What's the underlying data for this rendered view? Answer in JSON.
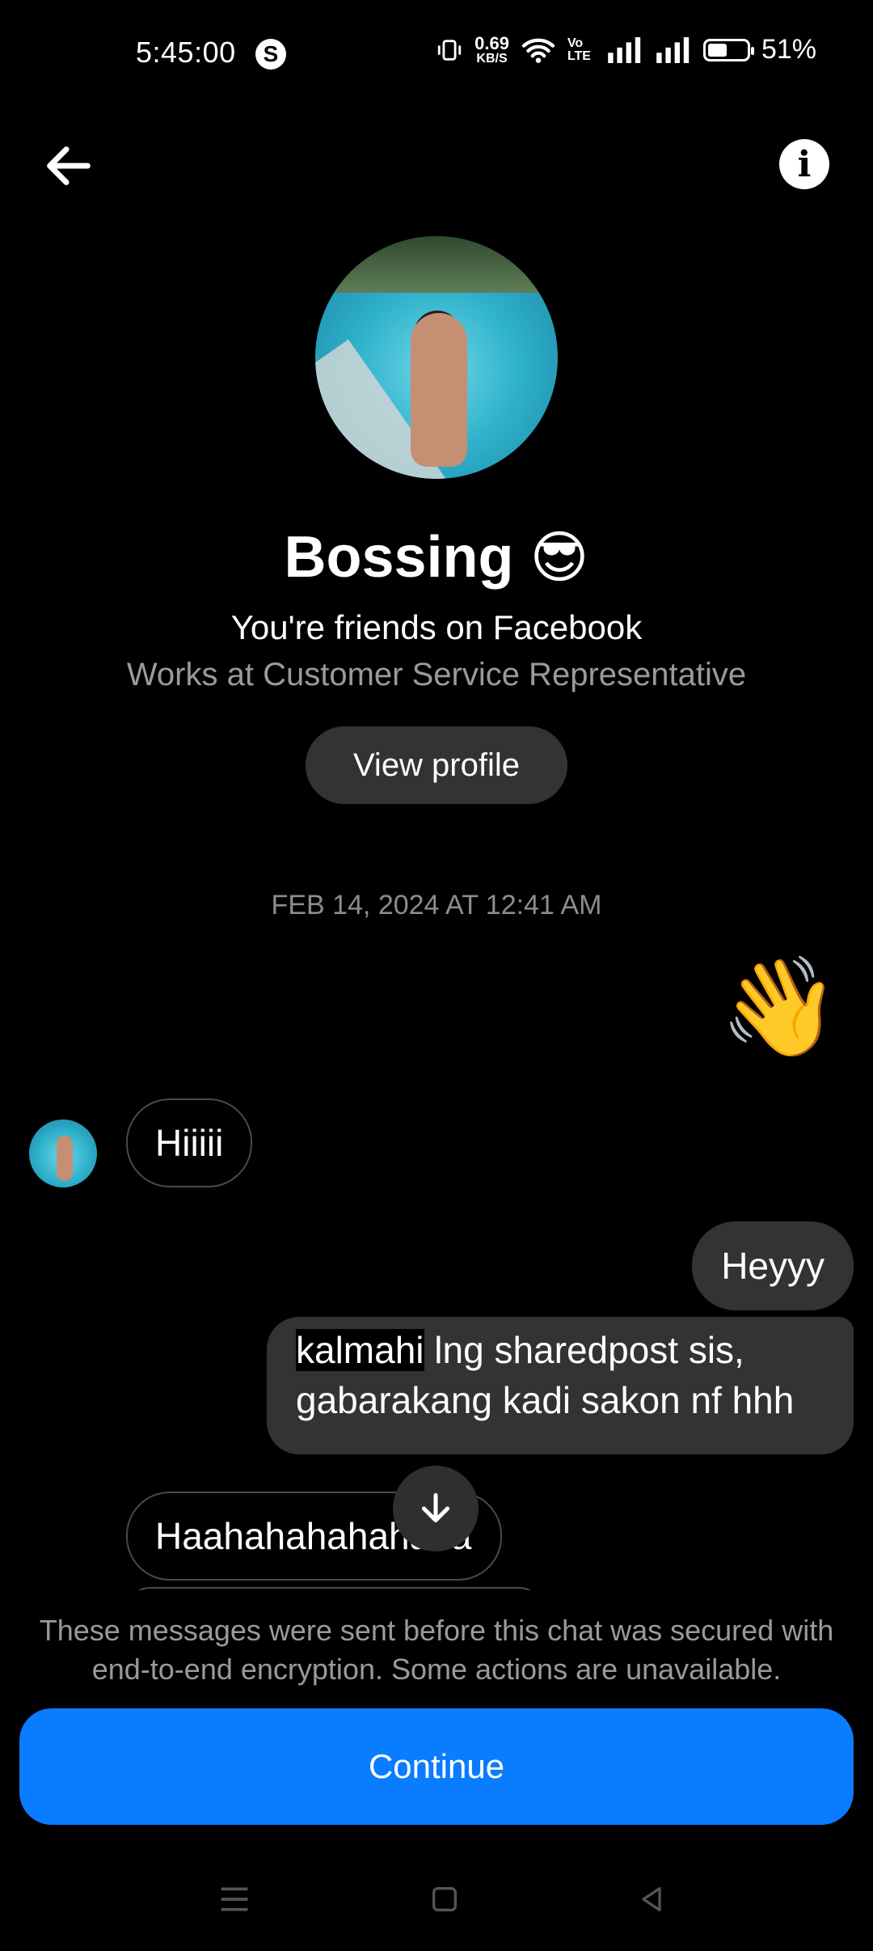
{
  "status_bar": {
    "time": "5:45:00",
    "app_badge": "S",
    "net_speed": "0.69",
    "net_unit": "KB/S",
    "volte": "Vo LTE",
    "battery": "51%",
    "battery_level": 0.51
  },
  "profile": {
    "name": "Bossing",
    "name_emoji": "😎",
    "friends_text": "You're friends on Facebook",
    "work_text": "Works at Customer Service Representative",
    "view_profile_label": "View profile"
  },
  "conversation": {
    "timestamp": "FEB 14, 2024 AT 12:41 AM",
    "wave_emoji": "👋",
    "msg_in_1": "Hiiiii",
    "msg_out_1": "Heyyy",
    "msg_out_2_highlight": "kalmahi",
    "msg_out_2_rest": " lng sharedpost sis, gabarakang kadi sakon nf hhh",
    "msg_in_2": "Haahahahahahaha"
  },
  "footer": {
    "notice": "These messages were sent before this chat was secured with end-to-end encryption. Some actions are unavailable.",
    "continue_label": "Continue"
  },
  "colors": {
    "accent": "#0a7cff",
    "bubble_out": "#333334",
    "background": "#000000"
  }
}
